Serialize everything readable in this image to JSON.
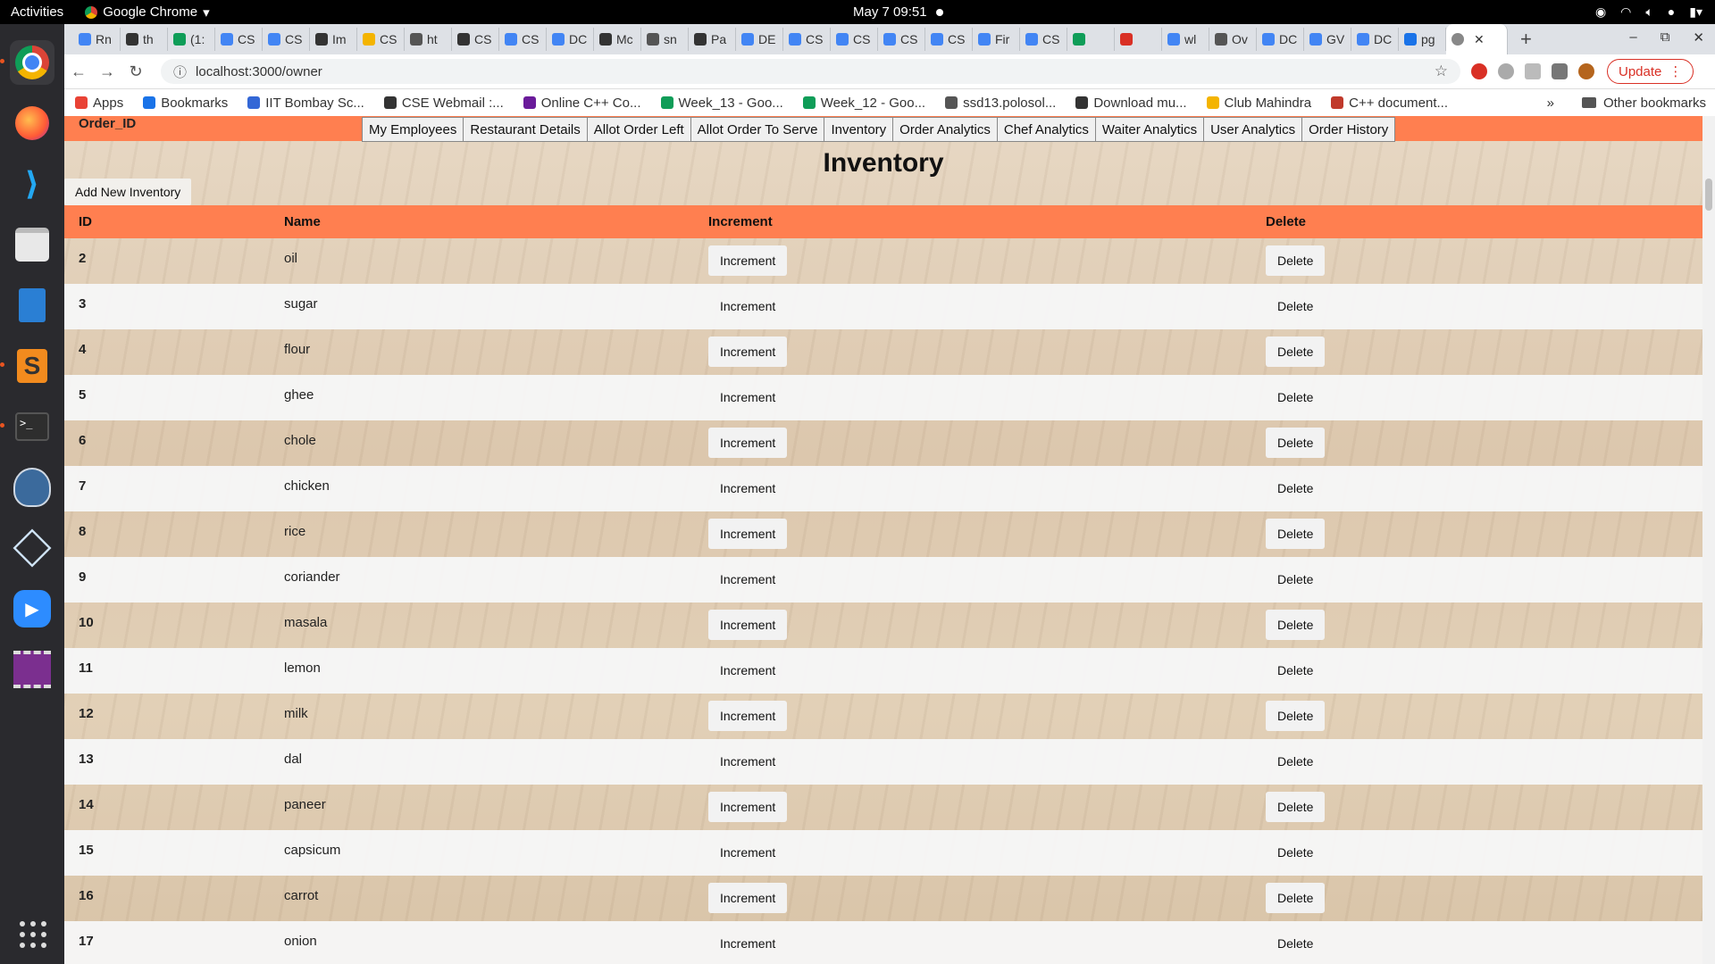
{
  "os": {
    "activities": "Activities",
    "app_name": "Google Chrome",
    "clock": "May 7  09:51"
  },
  "browser": {
    "tabs": [
      "Rn",
      "th",
      "(1:",
      "CS",
      "CS",
      "Im",
      "CS",
      "ht",
      "CS",
      "CS",
      "DC",
      "Mc",
      "sn",
      "Pa",
      "DE",
      "CS",
      "CS",
      "CS",
      "CS",
      "Fir",
      "CS",
      "",
      "",
      "wl",
      "Ov",
      "DC",
      "GV",
      "DC",
      "pg"
    ],
    "url": "localhost:3000/owner",
    "update_label": "Update",
    "bookmarks": [
      "Apps",
      "Bookmarks",
      "IIT Bombay Sc...",
      "CSE Webmail :...",
      "Online C++ Co...",
      "Week_13 - Goo...",
      "Week_12 - Goo...",
      "ssd13.polosol...",
      "Download mu...",
      "Club Mahindra",
      "C++ document..."
    ],
    "other_bookmarks": "Other bookmarks"
  },
  "page": {
    "order_id_label": "Order_ID",
    "nav_links": [
      "My Employees",
      "Restaurant Details",
      "Allot Order Left",
      "Allot Order To Serve",
      "Inventory",
      "Order Analytics",
      "Chef Analytics",
      "Waiter Analytics",
      "User Analytics",
      "Order History"
    ],
    "title": "Inventory",
    "add_button": "Add New Inventory",
    "columns": [
      "ID",
      "Name",
      "Increment",
      "Delete"
    ],
    "rows": [
      {
        "id": "2",
        "name": "oil"
      },
      {
        "id": "3",
        "name": "sugar"
      },
      {
        "id": "4",
        "name": "flour"
      },
      {
        "id": "5",
        "name": "ghee"
      },
      {
        "id": "6",
        "name": "chole"
      },
      {
        "id": "7",
        "name": "chicken"
      },
      {
        "id": "8",
        "name": "rice"
      },
      {
        "id": "9",
        "name": "coriander"
      },
      {
        "id": "10",
        "name": "masala"
      },
      {
        "id": "11",
        "name": "lemon"
      },
      {
        "id": "12",
        "name": "milk"
      },
      {
        "id": "13",
        "name": "dal"
      },
      {
        "id": "14",
        "name": "paneer"
      },
      {
        "id": "15",
        "name": "capsicum"
      },
      {
        "id": "16",
        "name": "carrot"
      },
      {
        "id": "17",
        "name": "onion"
      }
    ],
    "increment_label": "Increment",
    "delete_label": "Delete"
  }
}
